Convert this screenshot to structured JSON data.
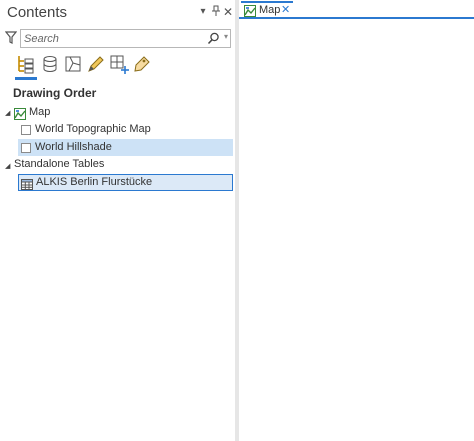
{
  "pane": {
    "title": "Contents",
    "search_placeholder": "Search",
    "drawing_order_label": "Drawing Order"
  },
  "toc": {
    "map": "Map",
    "layers": [
      {
        "label": "World Topographic Map",
        "checked": false,
        "selected": false
      },
      {
        "label": "World Hillshade",
        "checked": false,
        "selected": true
      }
    ],
    "standalone_tables_label": "Standalone Tables",
    "tables": [
      {
        "label": "ALKIS Berlin Flurstücke",
        "selected": true
      }
    ]
  },
  "tabs": [
    {
      "label": "Map",
      "active": true
    }
  ],
  "colors": {
    "accent": "#2b79d0",
    "selection": "#cde2f6"
  }
}
